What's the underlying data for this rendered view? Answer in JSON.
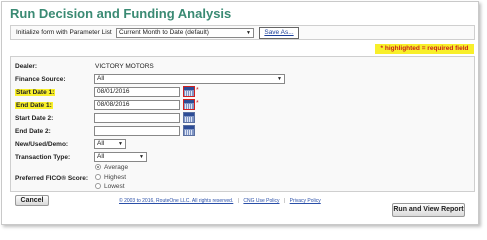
{
  "title": "Run Decision and Funding Analysis",
  "parameter_list": {
    "label": "Initialize form with Parameter List",
    "selected": "Current Month to Date (default)",
    "save_as": "Save As..."
  },
  "required_note": "* highlighted = required field",
  "form": {
    "dealer": {
      "label": "Dealer:",
      "value": "VICTORY MOTORS"
    },
    "finance_source": {
      "label": "Finance Source:",
      "value": "All"
    },
    "start_date_1": {
      "label": "Start Date 1:",
      "value": "08/01/2016",
      "required_mark": "*"
    },
    "end_date_1": {
      "label": "End Date 1:",
      "value": "08/08/2016",
      "required_mark": "*"
    },
    "start_date_2": {
      "label": "Start Date 2:",
      "value": ""
    },
    "end_date_2": {
      "label": "End Date 2:",
      "value": ""
    },
    "new_used_demo": {
      "label": "New/Used/Demo:",
      "value": "All"
    },
    "transaction_type": {
      "label": "Transaction Type:",
      "value": "All"
    },
    "fico": {
      "label": "Preferred FICO® Score:",
      "options": [
        "Average",
        "Highest",
        "Lowest"
      ],
      "selected": "Average"
    }
  },
  "buttons": {
    "cancel": "Cancel",
    "run": "Run and View Report"
  },
  "footer": {
    "copyright": "© 2003 to 2016, RouteOne LLC. All rights reserved.",
    "cng_use_policy": "CNG Use Policy",
    "privacy_policy": "Privacy Policy"
  },
  "colors": {
    "title": "#3a8a73",
    "highlight": "#f8ef2a",
    "required": "#d02020"
  }
}
